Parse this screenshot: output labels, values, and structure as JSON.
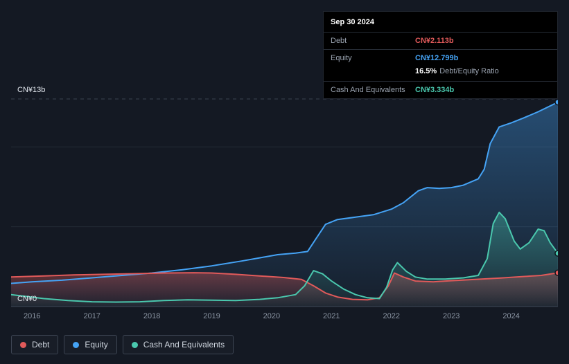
{
  "colors": {
    "background": "#141923",
    "grid": "#232a35",
    "axis": "#3a4350",
    "text_muted": "#8b95a3",
    "text_light": "#e4e9f0",
    "debt": "#e15a5a",
    "equity": "#45a3f5",
    "cash": "#4ac8ae"
  },
  "tooltip": {
    "date": "Sep 30 2024",
    "debt_label": "Debt",
    "debt_value": "CN¥2.113b",
    "equity_label": "Equity",
    "equity_value": "CN¥12.799b",
    "ratio_value": "16.5%",
    "ratio_label": "Debt/Equity Ratio",
    "cash_label": "Cash And Equivalents",
    "cash_value": "CN¥3.334b"
  },
  "legend": {
    "items": [
      {
        "label": "Debt",
        "color": "#e15a5a"
      },
      {
        "label": "Equity",
        "color": "#45a3f5"
      },
      {
        "label": "Cash And Equivalents",
        "color": "#4ac8ae"
      }
    ]
  },
  "chart_data": {
    "type": "area",
    "x_axis": {
      "min": 2015.65,
      "max": 2024.78,
      "tick_values": [
        2016,
        2017,
        2018,
        2019,
        2020,
        2021,
        2022,
        2023,
        2024
      ]
    },
    "y_axis": {
      "min": 0,
      "max": 13,
      "unit": "CN¥ billions",
      "top_label": "CN¥13b",
      "bottom_label": "CN¥0",
      "gridlines": [
        {
          "value": 13,
          "style": "dashed"
        },
        {
          "value": 10,
          "style": "solid"
        },
        {
          "value": 5,
          "style": "solid"
        },
        {
          "value": 0,
          "style": "axis"
        }
      ]
    },
    "series": [
      {
        "name": "Equity",
        "color": "#45a3f5",
        "x": [
          2015.65,
          2016.0,
          2016.5,
          2017.0,
          2017.5,
          2018.0,
          2018.5,
          2019.0,
          2019.5,
          2019.8,
          2020.1,
          2020.4,
          2020.6,
          2020.75,
          2020.9,
          2021.1,
          2021.4,
          2021.7,
          2022.0,
          2022.2,
          2022.45,
          2022.6,
          2022.8,
          2023.0,
          2023.2,
          2023.45,
          2023.55,
          2023.65,
          2023.8,
          2024.0,
          2024.2,
          2024.45,
          2024.78
        ],
        "values": [
          1.45,
          1.55,
          1.65,
          1.8,
          1.95,
          2.1,
          2.3,
          2.55,
          2.85,
          3.05,
          3.25,
          3.35,
          3.45,
          4.3,
          5.15,
          5.45,
          5.6,
          5.75,
          6.1,
          6.5,
          7.25,
          7.45,
          7.4,
          7.45,
          7.6,
          8.0,
          8.6,
          10.2,
          11.25,
          11.5,
          11.8,
          12.2,
          12.799
        ]
      },
      {
        "name": "Debt",
        "color": "#e15a5a",
        "x": [
          2015.65,
          2016.2,
          2016.7,
          2017.2,
          2017.7,
          2018.2,
          2018.7,
          2019.0,
          2019.4,
          2019.8,
          2020.2,
          2020.5,
          2020.7,
          2020.9,
          2021.1,
          2021.35,
          2021.6,
          2021.8,
          2021.95,
          2022.05,
          2022.2,
          2022.4,
          2022.7,
          2023.0,
          2023.4,
          2023.8,
          2024.2,
          2024.5,
          2024.78
        ],
        "values": [
          1.85,
          1.92,
          1.98,
          2.02,
          2.06,
          2.1,
          2.12,
          2.1,
          2.02,
          1.92,
          1.82,
          1.7,
          1.3,
          0.85,
          0.6,
          0.45,
          0.42,
          0.55,
          1.3,
          2.1,
          1.85,
          1.6,
          1.55,
          1.62,
          1.7,
          1.78,
          1.88,
          1.95,
          2.113
        ]
      },
      {
        "name": "Cash And Equivalents",
        "color": "#4ac8ae",
        "x": [
          2015.65,
          2016.2,
          2016.6,
          2017.0,
          2017.4,
          2017.8,
          2018.2,
          2018.6,
          2019.0,
          2019.4,
          2019.8,
          2020.1,
          2020.4,
          2020.55,
          2020.7,
          2020.85,
          2021.0,
          2021.2,
          2021.4,
          2021.6,
          2021.8,
          2021.92,
          2022.02,
          2022.1,
          2022.25,
          2022.4,
          2022.6,
          2022.9,
          2023.2,
          2023.45,
          2023.6,
          2023.7,
          2023.8,
          2023.9,
          2024.05,
          2024.15,
          2024.3,
          2024.45,
          2024.55,
          2024.65,
          2024.78
        ],
        "values": [
          0.75,
          0.5,
          0.38,
          0.3,
          0.28,
          0.3,
          0.38,
          0.42,
          0.4,
          0.38,
          0.45,
          0.55,
          0.75,
          1.3,
          2.25,
          2.05,
          1.6,
          1.1,
          0.75,
          0.55,
          0.5,
          1.2,
          2.3,
          2.75,
          2.2,
          1.85,
          1.72,
          1.72,
          1.8,
          1.95,
          3.0,
          5.2,
          5.9,
          5.5,
          4.1,
          3.6,
          4.0,
          4.85,
          4.75,
          4.0,
          3.334
        ]
      }
    ]
  }
}
